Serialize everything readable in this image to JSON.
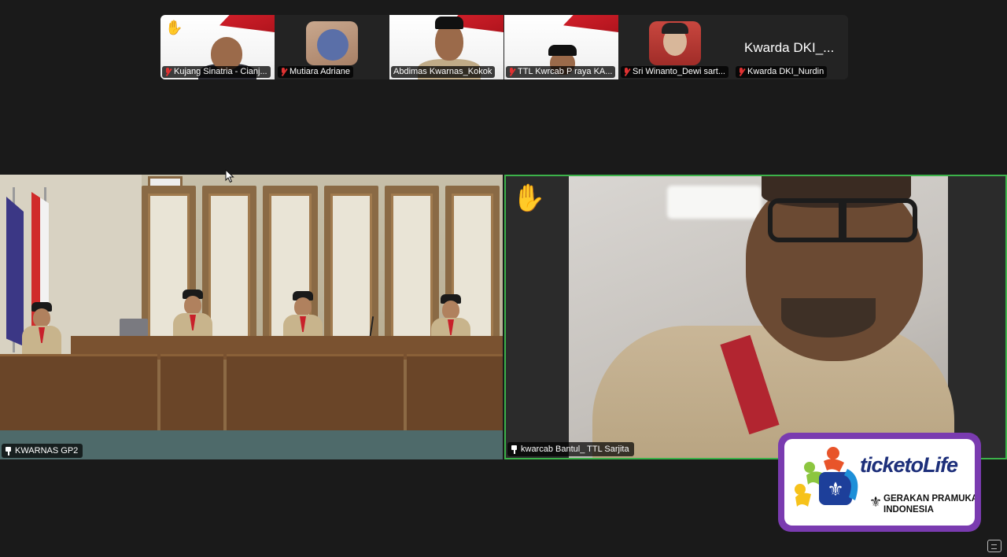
{
  "thumbnails": [
    {
      "name": "Kujang Sinatria - Cianj...",
      "muted": true,
      "hand_raised": true
    },
    {
      "name": "Mutiara Adriane",
      "muted": true
    },
    {
      "name": "Abdimas Kwarnas_Kokok",
      "muted": false
    },
    {
      "name": "TTL Kwrcab P raya KA...",
      "muted": true
    },
    {
      "name": "Sri Winanto_Dewi sart...",
      "muted": true
    },
    {
      "name": "Kwarda DKI_Nurdin",
      "muted": true,
      "display_name": "Kwarda DKI_..."
    }
  ],
  "main_tiles": {
    "left": {
      "name": "KWARNAS GP2",
      "pinned": true
    },
    "right": {
      "name": "kwarcab Bantul_ TTL Sarjita",
      "pinned": true,
      "hand_raised": true,
      "active_speaker": true
    }
  },
  "logo": {
    "title": "ticketoLife",
    "subtitle_line1": "GERAKAN PRAMUKA",
    "subtitle_line2": "INDONESIA"
  },
  "colors": {
    "background": "#1a1a1a",
    "active_speaker_border": "#3cb24a",
    "logo_frame": "#7a3bb0",
    "mute_red": "#e03232"
  },
  "icons": {
    "hand": "✋"
  }
}
